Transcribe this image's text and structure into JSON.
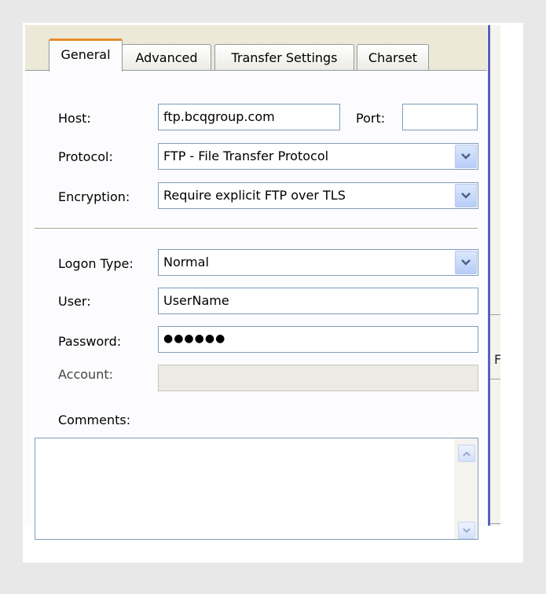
{
  "tabs": [
    {
      "label": "General",
      "active": true
    },
    {
      "label": "Advanced"
    },
    {
      "label": "Transfer Settings"
    },
    {
      "label": "Charset"
    }
  ],
  "host": {
    "label": "Host:",
    "value": "ftp.bcqgroup.com"
  },
  "port": {
    "label": "Port:",
    "value": ""
  },
  "protocol": {
    "label": "Protocol:",
    "value": "FTP - File Transfer Protocol"
  },
  "encryption": {
    "label": "Encryption:",
    "value": "Require explicit FTP over TLS"
  },
  "logon_type": {
    "label": "Logon Type:",
    "value": "Normal"
  },
  "user": {
    "label": "User:",
    "value": "UserName"
  },
  "password": {
    "label": "Password:",
    "value": "●●●●●●"
  },
  "account": {
    "label": "Account:",
    "value": ""
  },
  "comments": {
    "label": "Comments:",
    "value": ""
  },
  "right_strip": {
    "cut_text": "FP"
  },
  "colors": {
    "active_tab_accent": "#e68b2c",
    "window_border": "#5a63b8",
    "field_border": "#7f9db9"
  },
  "icons": {
    "combo": "chevron-down-icon",
    "scroll_up": "scroll-up-icon",
    "scroll_down": "scroll-down-icon"
  }
}
